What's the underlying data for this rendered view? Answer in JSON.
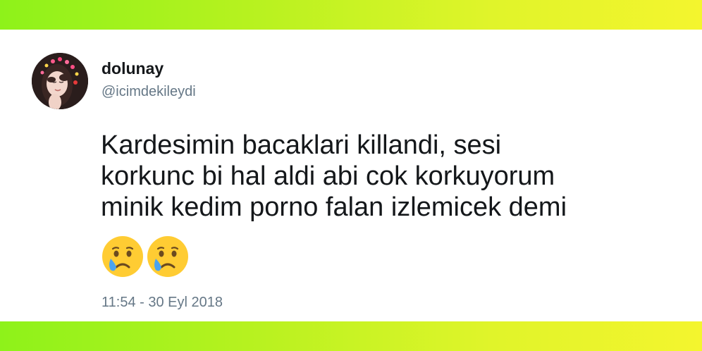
{
  "user": {
    "name": "dolunay",
    "handle": "@icimdekileydi"
  },
  "tweet": {
    "lines": [
      "Kardesimin bacaklari killandi, sesi",
      "korkunc bi hal aldi abi cok korkuyorum",
      "minik kedim porno falan izlemicek demi"
    ],
    "emojis": [
      "crying-face-emoji",
      "crying-face-emoji"
    ],
    "timestamp": "11:54 - 30 Eyl 2018"
  },
  "colors": {
    "banner_start": "#8ef21a",
    "banner_end": "#f4f52e",
    "text": "#14171a",
    "muted": "#657786"
  }
}
